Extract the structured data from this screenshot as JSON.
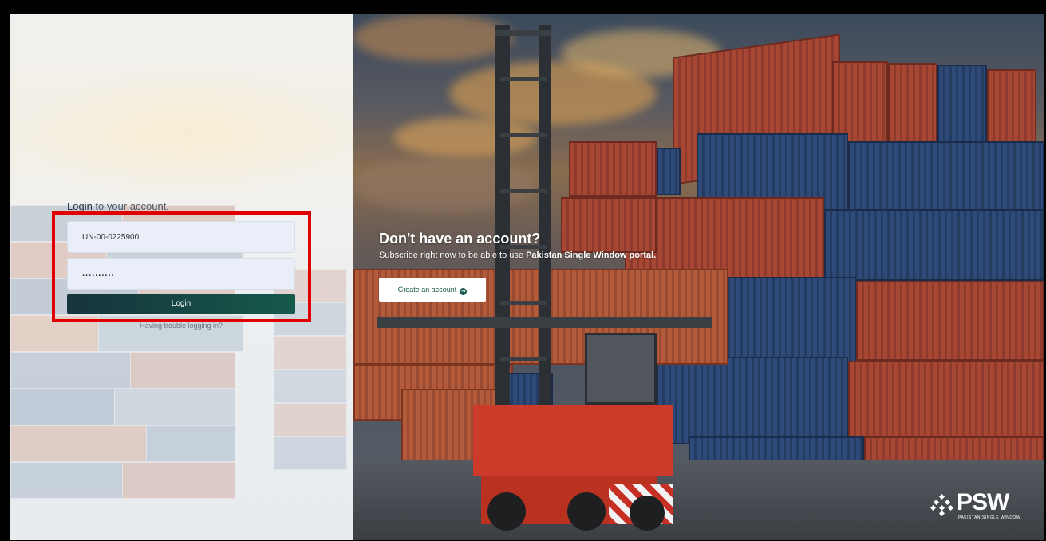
{
  "login": {
    "heading_strong": "Login",
    "heading_rest": " to your account.",
    "username_value": "UN-00-0225900",
    "password_value": "..........",
    "login_label": "Login",
    "trouble_link": "Having trouble logging in?"
  },
  "promo": {
    "title": "Don't have an account?",
    "subtitle_prefix": "Subscribe right now to be able to use ",
    "subtitle_strong": "Pakistan Single Window portal.",
    "create_label": "Create an account",
    "create_icon": "arrow-circle-right-icon"
  },
  "brand": {
    "logo_text": "PSW",
    "logo_tagline": "PAKISTAN SINGLE WINDOW"
  },
  "colors": {
    "login_button": "#17333c",
    "accent_green": "#17584a",
    "highlight_red": "#e00000"
  }
}
